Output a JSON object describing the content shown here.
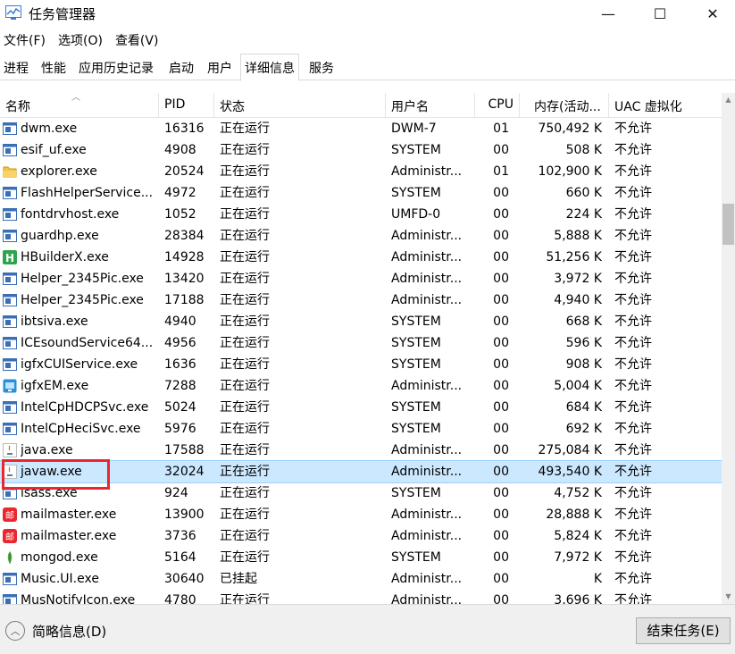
{
  "window": {
    "title": "任务管理器",
    "minimize": "—",
    "maximize": "☐",
    "close": "✕"
  },
  "menu": [
    "文件(F)",
    "选项(O)",
    "查看(V)"
  ],
  "tabs": [
    "进程",
    "性能",
    "应用历史记录",
    "启动",
    "用户",
    "详细信息",
    "服务"
  ],
  "active_tab": "详细信息",
  "columns": {
    "name": "名称",
    "pid": "PID",
    "status": "状态",
    "user": "用户名",
    "cpu": "CPU",
    "mem": "内存(活动...",
    "uac": "UAC 虚拟化"
  },
  "rows": [
    {
      "icon": "window-app-icon",
      "name": "dwm.exe",
      "pid": "16316",
      "status": "正在运行",
      "user": "DWM-7",
      "cpu": "01",
      "mem": "750,492 K",
      "uac": "不允许"
    },
    {
      "icon": "window-app-icon",
      "name": "esif_uf.exe",
      "pid": "4908",
      "status": "正在运行",
      "user": "SYSTEM",
      "cpu": "00",
      "mem": "508 K",
      "uac": "不允许"
    },
    {
      "icon": "folder-icon",
      "name": "explorer.exe",
      "pid": "20524",
      "status": "正在运行",
      "user": "Administr...",
      "cpu": "01",
      "mem": "102,900 K",
      "uac": "不允许"
    },
    {
      "icon": "window-app-icon",
      "name": "FlashHelperService...",
      "pid": "4972",
      "status": "正在运行",
      "user": "SYSTEM",
      "cpu": "00",
      "mem": "660 K",
      "uac": "不允许"
    },
    {
      "icon": "window-app-icon",
      "name": "fontdrvhost.exe",
      "pid": "1052",
      "status": "正在运行",
      "user": "UMFD-0",
      "cpu": "00",
      "mem": "224 K",
      "uac": "不允许"
    },
    {
      "icon": "window-app-icon",
      "name": "guardhp.exe",
      "pid": "28384",
      "status": "正在运行",
      "user": "Administr...",
      "cpu": "00",
      "mem": "5,888 K",
      "uac": "不允许"
    },
    {
      "icon": "hbuilder-icon",
      "name": "HBuilderX.exe",
      "pid": "14928",
      "status": "正在运行",
      "user": "Administr...",
      "cpu": "00",
      "mem": "51,256 K",
      "uac": "不允许"
    },
    {
      "icon": "window-app-icon",
      "name": "Helper_2345Pic.exe",
      "pid": "13420",
      "status": "正在运行",
      "user": "Administr...",
      "cpu": "00",
      "mem": "3,972 K",
      "uac": "不允许"
    },
    {
      "icon": "window-app-icon",
      "name": "Helper_2345Pic.exe",
      "pid": "17188",
      "status": "正在运行",
      "user": "Administr...",
      "cpu": "00",
      "mem": "4,940 K",
      "uac": "不允许"
    },
    {
      "icon": "window-app-icon",
      "name": "ibtsiva.exe",
      "pid": "4940",
      "status": "正在运行",
      "user": "SYSTEM",
      "cpu": "00",
      "mem": "668 K",
      "uac": "不允许"
    },
    {
      "icon": "window-app-icon",
      "name": "ICEsoundService64...",
      "pid": "4956",
      "status": "正在运行",
      "user": "SYSTEM",
      "cpu": "00",
      "mem": "596 K",
      "uac": "不允许"
    },
    {
      "icon": "window-app-icon",
      "name": "igfxCUIService.exe",
      "pid": "1636",
      "status": "正在运行",
      "user": "SYSTEM",
      "cpu": "00",
      "mem": "908 K",
      "uac": "不允许"
    },
    {
      "icon": "intel-graphics-icon",
      "name": "igfxEM.exe",
      "pid": "7288",
      "status": "正在运行",
      "user": "Administr...",
      "cpu": "00",
      "mem": "5,004 K",
      "uac": "不允许"
    },
    {
      "icon": "window-app-icon",
      "name": "IntelCpHDCPSvc.exe",
      "pid": "5024",
      "status": "正在运行",
      "user": "SYSTEM",
      "cpu": "00",
      "mem": "684 K",
      "uac": "不允许"
    },
    {
      "icon": "window-app-icon",
      "name": "IntelCpHeciSvc.exe",
      "pid": "5976",
      "status": "正在运行",
      "user": "SYSTEM",
      "cpu": "00",
      "mem": "692 K",
      "uac": "不允许"
    },
    {
      "icon": "java-icon",
      "name": "java.exe",
      "pid": "17588",
      "status": "正在运行",
      "user": "Administr...",
      "cpu": "00",
      "mem": "275,084 K",
      "uac": "不允许"
    },
    {
      "icon": "java-icon",
      "name": "javaw.exe",
      "pid": "32024",
      "status": "正在运行",
      "user": "Administr...",
      "cpu": "00",
      "mem": "493,540 K",
      "uac": "不允许"
    },
    {
      "icon": "window-app-icon",
      "name": "lsass.exe",
      "pid": "924",
      "status": "正在运行",
      "user": "SYSTEM",
      "cpu": "00",
      "mem": "4,752 K",
      "uac": "不允许"
    },
    {
      "icon": "mailmaster-icon",
      "name": "mailmaster.exe",
      "pid": "13900",
      "status": "正在运行",
      "user": "Administr...",
      "cpu": "00",
      "mem": "28,888 K",
      "uac": "不允许"
    },
    {
      "icon": "mailmaster-icon",
      "name": "mailmaster.exe",
      "pid": "3736",
      "status": "正在运行",
      "user": "Administr...",
      "cpu": "00",
      "mem": "5,824 K",
      "uac": "不允许"
    },
    {
      "icon": "mongodb-leaf-icon",
      "name": "mongod.exe",
      "pid": "5164",
      "status": "正在运行",
      "user": "SYSTEM",
      "cpu": "00",
      "mem": "7,972 K",
      "uac": "不允许"
    },
    {
      "icon": "window-app-icon",
      "name": "Music.UI.exe",
      "pid": "30640",
      "status": "已挂起",
      "user": "Administr...",
      "cpu": "00",
      "mem": "K",
      "uac": "不允许"
    },
    {
      "icon": "window-app-icon",
      "name": "MusNotifyIcon.exe",
      "pid": "4780",
      "status": "正在运行",
      "user": "Administr...",
      "cpu": "00",
      "mem": "3,696 K",
      "uac": "不允许"
    }
  ],
  "selected_row": 16,
  "mail_icon_glyph": "邮",
  "footer": {
    "fewer_details": "简略信息(D)",
    "end_task": "结束任务(E)"
  },
  "colors": {
    "selection": "#cce8ff",
    "highlight_box": "#e8272e"
  }
}
